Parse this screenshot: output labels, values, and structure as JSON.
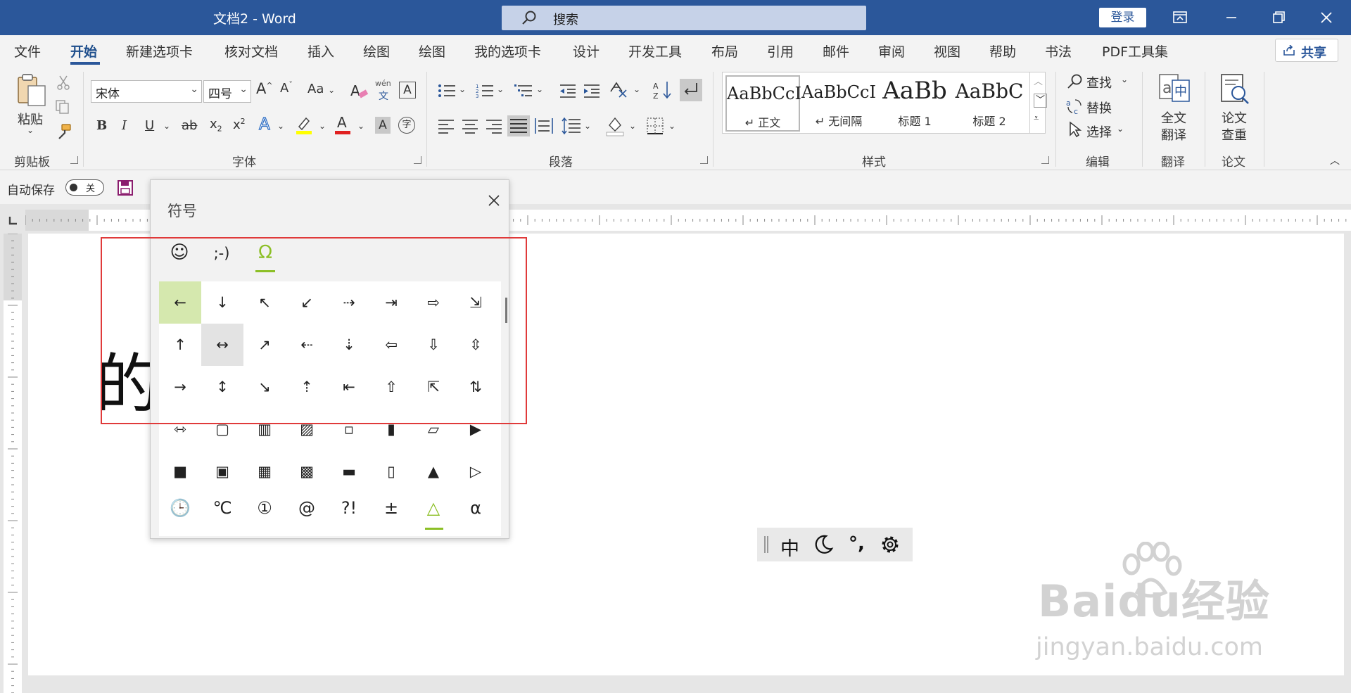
{
  "window": {
    "title": "文档2  -  Word",
    "search_placeholder": "搜索",
    "login_label": "登录"
  },
  "menu": {
    "tabs": [
      "文件",
      "开始",
      "新建选项卡",
      "核对文档",
      "插入",
      "绘图",
      "绘图",
      "我的选项卡",
      "设计",
      "开发工具",
      "布局",
      "引用",
      "邮件",
      "审阅",
      "视图",
      "帮助",
      "书法",
      "PDF工具集"
    ],
    "active_tab": "开始",
    "share_label": "共享"
  },
  "ribbon": {
    "clipboard": {
      "paste_label": "粘贴",
      "group_label": "剪贴板"
    },
    "font": {
      "font_name": "宋体",
      "font_size": "四号",
      "group_label": "字体",
      "grow": "A",
      "shrink": "A",
      "case": "Aa",
      "bold": "B",
      "italic": "I",
      "underline": "U",
      "strike": "ab",
      "subscript": "x",
      "subscript_mark": "2",
      "superscript": "x",
      "superscript_mark": "2",
      "text_effect": "A",
      "font_color": "A",
      "shading": "A",
      "phonetic_top": "wén",
      "phonetic_bottom": "文",
      "border_char": "A",
      "enclose_char": "字"
    },
    "paragraph": {
      "group_label": "段落"
    },
    "styles": {
      "group_label": "样式",
      "items": [
        {
          "preview": "AaBbCcI",
          "name": "↵ 正文"
        },
        {
          "preview": "AaBbCcI",
          "name": "↵ 无间隔"
        },
        {
          "preview": "AaBb",
          "name": "标题 1"
        },
        {
          "preview": "AaBbC",
          "name": "标题 2"
        }
      ]
    },
    "editing": {
      "find_label": "查找",
      "replace_label": "替换",
      "select_label": "选择",
      "group_label": "编辑"
    },
    "translate": {
      "full_label_1": "全文",
      "full_label_2": "翻译",
      "group_label": "翻译"
    },
    "paper": {
      "check_label_1": "论文",
      "check_label_2": "查重",
      "group_label": "论文"
    }
  },
  "quick_access": {
    "autosave_label": "自动保存",
    "toggle_state": "关"
  },
  "document": {
    "text": "的"
  },
  "symbol_panel": {
    "title": "符号",
    "tabs": [
      "☺",
      ";-)",
      "Ω"
    ],
    "active_tab_index": 2,
    "symbols": [
      [
        "←",
        "↓",
        "↖",
        "↙",
        "⇢",
        "⇥",
        "⇨",
        "⇲"
      ],
      [
        "↑",
        "↔",
        "↗",
        "⇠",
        "⇣",
        "⇦",
        "⇩",
        "⇳"
      ],
      [
        "→",
        "↕",
        "↘",
        "⇡",
        "⇤",
        "⇧",
        "⇱",
        "⇅"
      ],
      [
        "⇿",
        "▢",
        "▥",
        "▨",
        "▫",
        "▮",
        "▱",
        "▶"
      ],
      [
        "■",
        "▣",
        "▦",
        "▩",
        "▬",
        "▯",
        "▲",
        "▷"
      ],
      [
        "🕒",
        "℃",
        "①",
        "@",
        "?!",
        "±",
        "△",
        "α"
      ]
    ]
  },
  "ime_toolbar": {
    "mode": "中",
    "punct": "°,"
  },
  "watermark": {
    "text": "Baidu经验",
    "sub": "jingyan.baidu.com"
  },
  "colors": {
    "title_bar": "#2b579a",
    "highlight": "#d5e8ae",
    "accent_green": "#8cbf26",
    "annotation_red": "#e03a3a",
    "font_color_red": "#e02020",
    "highlight_yellow": "#ffff00"
  }
}
